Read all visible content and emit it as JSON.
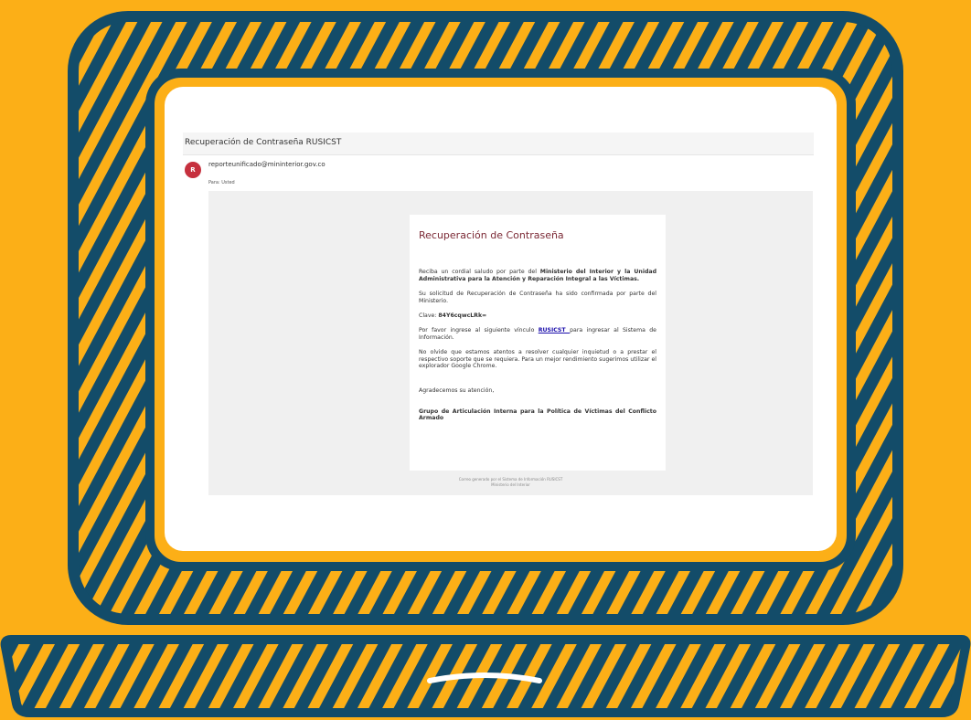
{
  "email": {
    "subject": "Recuperación de Contraseña RUSICST",
    "avatar_letter": "R",
    "sender": "reporteunificado@mininterior.gov.co",
    "recipient": "Para: Usted",
    "message": {
      "title": "Recuperación de Contraseña",
      "greeting_start": "Reciba un cordial saludo por parte del ",
      "greeting_bold": "Ministerio del Interior y la Unidad Administrativa para la Atención y Reparación Integral a las Víctimas.",
      "confirmation": "Su solicitud de Recuperación de Contraseña ha sido confirmada por parte del Ministerio.",
      "key_label": "Clave: ",
      "key_value": "84Y6cqwcLRk=",
      "link_before": "Por favor ingrese al siguiente vínculo ",
      "link_text": "RUSICST ",
      "link_after": "para ingresar al Sistema de Información.",
      "support": "No olvide que estamos atentos a resolver cualquier inquietud o a prestar el respectivo soporte que se requiera. Para un mejor rendimiento sugerimos utilizar el explorador Google Chrome.",
      "thanks": "Agradecemos su atención,",
      "signature": "Grupo de Articulación Interna para la Política de Víctimas del Conflicto Armado"
    },
    "footer": {
      "line1": "Correo generado por el Sistema de Información RUSICST",
      "line2": "Ministerio del Interior"
    }
  },
  "colors": {
    "background": "#fcaf17",
    "laptop_ink": "#134c69",
    "avatar": "#c6303e",
    "title": "#7b2935",
    "link": "#1a0dab"
  }
}
